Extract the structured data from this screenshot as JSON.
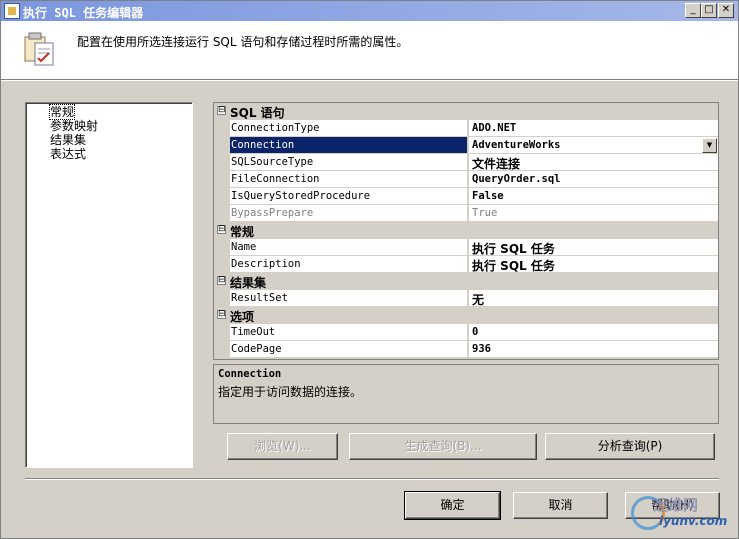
{
  "window": {
    "title": "执行 SQL 任务编辑器",
    "controls": {
      "minimize": "_",
      "maximize": "□",
      "close": "✕"
    }
  },
  "header": {
    "description": "配置在使用所选连接运行 SQL 语句和存储过程时所需的属性。",
    "icon": "task-config-icon"
  },
  "nav": {
    "items": [
      {
        "label": "常规",
        "selected": true
      },
      {
        "label": "参数映射",
        "selected": false
      },
      {
        "label": "结果集",
        "selected": false
      },
      {
        "label": "表达式",
        "selected": false
      }
    ]
  },
  "grid": {
    "toggle_symbol": "⊟",
    "categories": {
      "sql": "SQL 语句",
      "general": "常规",
      "resultset": "结果集",
      "options": "选项"
    },
    "props": {
      "connection_type": {
        "name": "ConnectionType",
        "value": "ADO.NET"
      },
      "connection": {
        "name": "Connection",
        "value": "AdventureWorks"
      },
      "sql_source_type": {
        "name": "SQLSourceType",
        "value": "文件连接"
      },
      "file_connection": {
        "name": "FileConnection",
        "value": "QueryOrder.sql"
      },
      "is_query_sp": {
        "name": "IsQueryStoredProcedure",
        "value": "False"
      },
      "bypass_prepare": {
        "name": "BypassPrepare",
        "value": "True"
      },
      "name": {
        "name": "Name",
        "value": "执行 SQL 任务"
      },
      "description": {
        "name": "Description",
        "value": "执行 SQL 任务"
      },
      "result_set": {
        "name": "ResultSet",
        "value": "无"
      },
      "timeout": {
        "name": "TimeOut",
        "value": "0"
      },
      "code_page": {
        "name": "CodePage",
        "value": "936"
      }
    }
  },
  "description_panel": {
    "title": "Connection",
    "text": "指定用于访问数据的连接。"
  },
  "buttons": {
    "browse": "浏览(W)...",
    "build_query": "生成查询(B)...",
    "parse_query": "分析查询(P)",
    "ok": "确定",
    "cancel": "取消",
    "help": "帮助(H)"
  },
  "watermark": {
    "top": "运维网",
    "bottom": "iyunv.com"
  },
  "colors": {
    "selection": "#0a246a",
    "face": "#d4d0c8",
    "title_start": "#7a96df",
    "title_end": "#a6b8e8"
  }
}
